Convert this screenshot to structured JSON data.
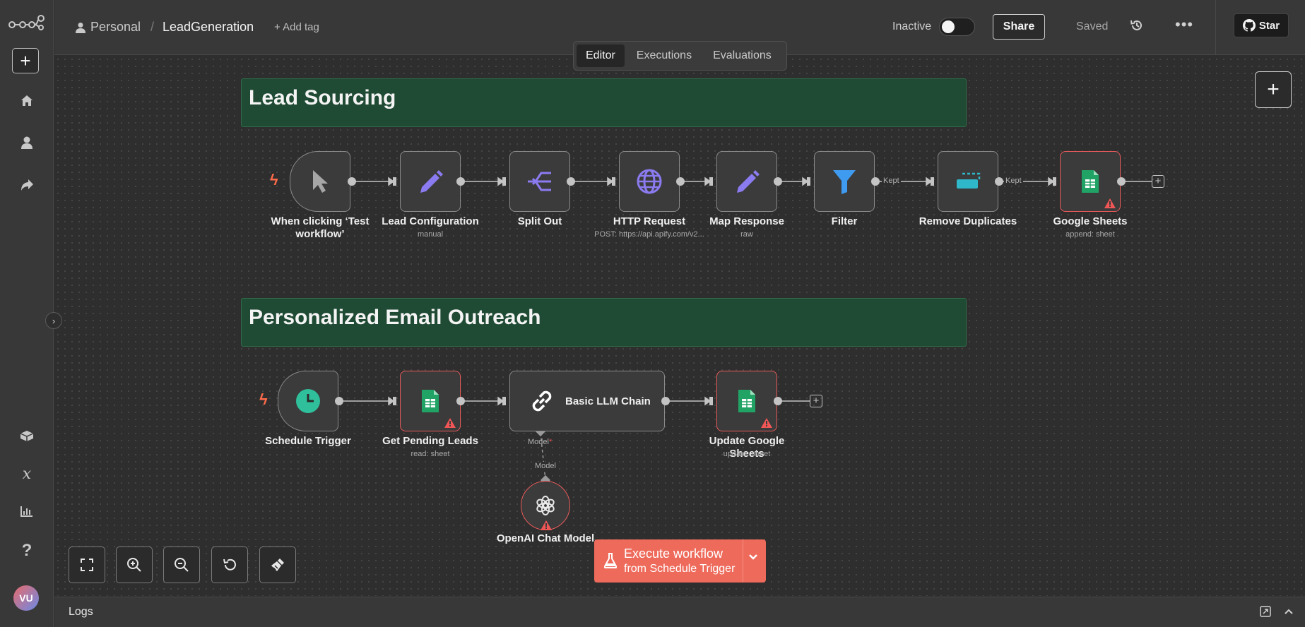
{
  "header": {
    "breadcrumb_project": "Personal",
    "breadcrumb_separator": "/",
    "workflow_name": "LeadGeneration",
    "add_tag": "+ Add tag",
    "active_status": "Inactive",
    "share_label": "Share",
    "save_status": "Saved",
    "star_label": "Star"
  },
  "tabs": [
    {
      "label": "Editor",
      "active": true
    },
    {
      "label": "Executions",
      "active": false
    },
    {
      "label": "Evaluations",
      "active": false
    }
  ],
  "sidebar": {
    "items": [
      {
        "icon": "n8n-logo-icon"
      },
      {
        "icon": "plus-icon"
      },
      {
        "icon": "home-icon"
      },
      {
        "icon": "user-icon"
      },
      {
        "icon": "share-arrow-icon"
      },
      {
        "icon": "templates-icon"
      },
      {
        "icon": "variables-icon"
      },
      {
        "icon": "insights-icon"
      },
      {
        "icon": "help-icon"
      }
    ],
    "avatar_initials": "VU"
  },
  "stickies": [
    {
      "title": "Lead Sourcing"
    },
    {
      "title": "Personalized Email Outreach"
    }
  ],
  "flow1": {
    "nodes": [
      {
        "label": "When clicking ‘Test workflow’",
        "subtitle": "",
        "icon": "cursor-icon"
      },
      {
        "label": "Lead Configuration",
        "subtitle": "manual",
        "icon": "pencil-icon"
      },
      {
        "label": "Split Out",
        "subtitle": "",
        "icon": "split-out-icon"
      },
      {
        "label": "HTTP Request",
        "subtitle": "POST: https://api.apify.com/v2...",
        "icon": "globe-icon"
      },
      {
        "label": "Map Response",
        "subtitle": "raw",
        "icon": "pencil-icon"
      },
      {
        "label": "Filter",
        "subtitle": "",
        "icon": "filter-icon"
      },
      {
        "label": "Remove Duplicates",
        "subtitle": "",
        "icon": "remove-duplicates-icon"
      },
      {
        "label": "Google Sheets",
        "subtitle": "append: sheet",
        "icon": "google-sheets-icon",
        "warning": true
      }
    ],
    "edge_labels": [
      "Kept",
      "Kept"
    ]
  },
  "flow2": {
    "nodes": [
      {
        "label": "Schedule Trigger",
        "subtitle": "",
        "icon": "clock-icon"
      },
      {
        "label": "Get Pending Leads",
        "subtitle": "read: sheet",
        "icon": "google-sheets-icon",
        "warning": true
      },
      {
        "label": "Basic LLM Chain",
        "subtitle": "",
        "icon": "link-chain-icon"
      },
      {
        "label": "Update Google Sheets",
        "subtitle": "update: sheet",
        "icon": "google-sheets-icon",
        "warning": true
      }
    ],
    "model_port_label": "Model",
    "model_required_mark": "*",
    "model_edge_label": "Model",
    "sub_node": {
      "label": "OpenAI Chat Model",
      "icon": "openai-icon",
      "warning": true
    }
  },
  "execute": {
    "main_label": "Execute workflow",
    "sub_label": "from Schedule Trigger"
  },
  "logs": {
    "label": "Logs"
  },
  "colors": {
    "accent": "#ee6a5b",
    "sticky_green": "#1f4a33",
    "error_border": "#e85a5a",
    "node_purple": "#8b7bf0",
    "sheets_green": "#21a366",
    "schedule_teal": "#2fbf9b",
    "filter_blue": "#3f9bf0",
    "dedupe_teal": "#2fb8c9"
  }
}
